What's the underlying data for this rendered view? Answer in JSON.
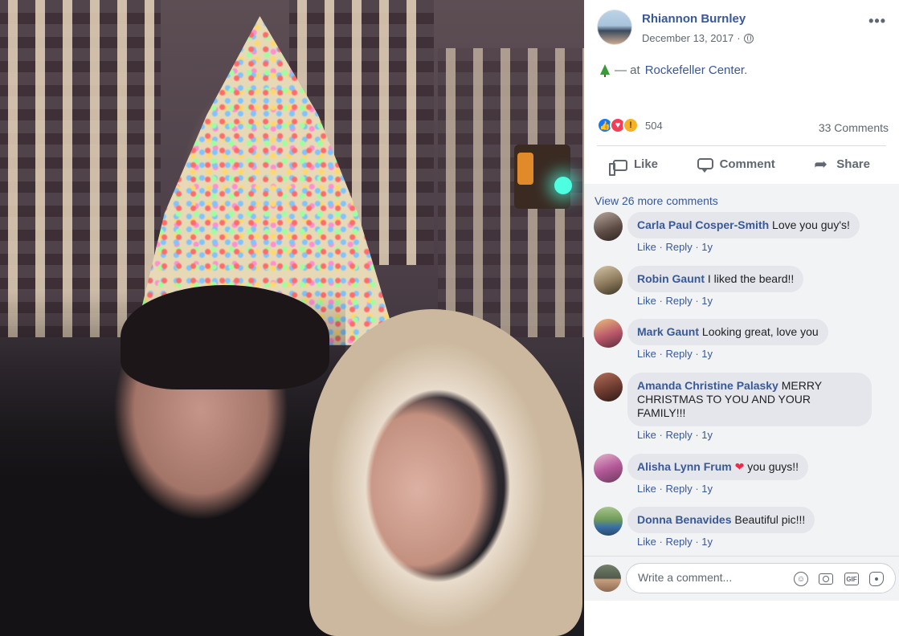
{
  "post": {
    "author": "Rhiannon Burnley",
    "date": "December 13, 2017",
    "date_suffix": "·",
    "privacy_icon": "globe-icon",
    "more_icon": "more-options-icon",
    "more_glyph": "•••",
    "status_prefix": "— at",
    "place": "Rockefeller Center",
    "place_suffix": ".",
    "status_icon": "christmas-tree-icon"
  },
  "reactions": {
    "types": [
      "like",
      "love",
      "wow"
    ],
    "like_glyph": "👍",
    "love_glyph": "♥",
    "wow_glyph": "!",
    "count": "504",
    "comments_count": "33 Comments"
  },
  "actions": {
    "like": "Like",
    "comment": "Comment",
    "share": "Share"
  },
  "comments": {
    "view_more": "View 26 more comments",
    "items": [
      {
        "name": "Carla Paul Cosper-Smith",
        "text": "Love you guy's!",
        "like": "Like",
        "reply": "Reply",
        "time": "1y",
        "sep": "·"
      },
      {
        "name": "Robin Gaunt",
        "text": "I liked the beard!!",
        "like": "Like",
        "reply": "Reply",
        "time": "1y",
        "sep": "·"
      },
      {
        "name": "Mark Gaunt",
        "text": "Looking great, love you",
        "like": "Like",
        "reply": "Reply",
        "time": "1y",
        "sep": "·"
      },
      {
        "name": "Amanda Christine Palasky",
        "text": "MERRY CHRISTMAS TO YOU AND YOUR FAMILY!!!",
        "like": "Like",
        "reply": "Reply",
        "time": "1y",
        "sep": "·"
      },
      {
        "name": "Alisha Lynn Frum",
        "text_heart": "❤",
        "text": "you guys!!",
        "like": "Like",
        "reply": "Reply",
        "time": "1y",
        "sep": "·"
      },
      {
        "name": "Donna Benavides",
        "text": "Beautiful pic!!!",
        "like": "Like",
        "reply": "Reply",
        "time": "1y",
        "sep": "·"
      }
    ]
  },
  "composer": {
    "placeholder": "Write a comment...",
    "emoji_glyph": "☺",
    "gif_label": "GIF"
  },
  "colors": {
    "link": "#385898",
    "meta": "#606770",
    "bubble": "#e4e6eb",
    "like_blue": "#1877f2",
    "love_red": "#f33e58",
    "wow_yellow": "#f7b125"
  }
}
